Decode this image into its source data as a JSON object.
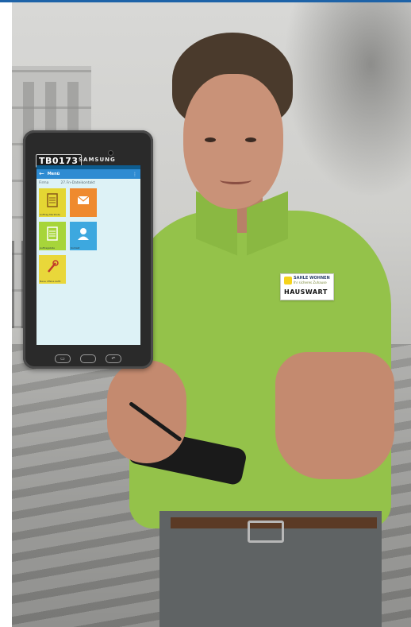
{
  "device": {
    "asset_tag": "TB0173",
    "brand": "SAMSUNG"
  },
  "app": {
    "title": "Menü",
    "tabs": [
      "Firma",
      "27.Fn-Dateikontakt"
    ],
    "tiles": [
      {
        "label": "Auftrag Merkliste",
        "color": "#e4d633",
        "icon": "document-list-icon"
      },
      {
        "label": "",
        "color": "#ef8a2e",
        "icon": "envelope-icon"
      },
      {
        "label": "Auftragsliste",
        "color": "#a7d53a",
        "icon": "document-list-icon"
      },
      {
        "label": "Kontakt",
        "color": "#3da8df",
        "icon": "person-icon"
      },
      {
        "label": "Neue offene Auftr.",
        "color": "#e9d73a",
        "icon": "wrench-icon"
      }
    ]
  },
  "badge": {
    "brand": "SAHLE WOHNEN",
    "tagline": "Ihr sicheres Zuhause",
    "role": "HAUSWART"
  },
  "colors": {
    "shirt": "#94c24a",
    "accent_bar": "#1e63a8",
    "app_bar": "#2e8bd2"
  }
}
